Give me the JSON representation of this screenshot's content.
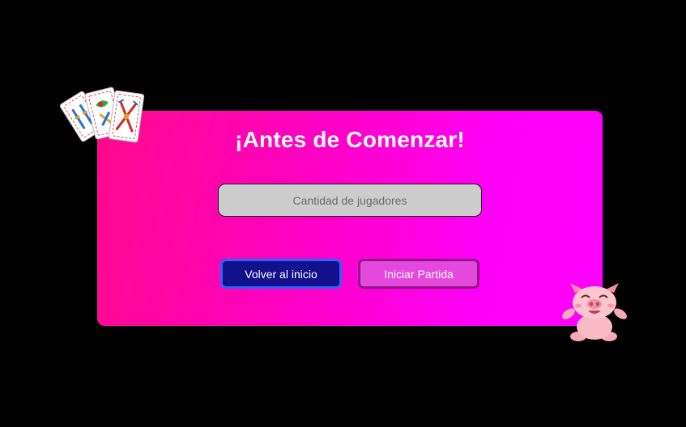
{
  "panel": {
    "title": "¡Antes de Comenzar!"
  },
  "players_input": {
    "placeholder": "Cantidad de jugadores",
    "value": ""
  },
  "buttons": {
    "back_label": "Volver al inicio",
    "start_label": "Iniciar Partida"
  },
  "decorations": {
    "cards_icon": "spanish-playing-cards-icon",
    "pig_icon": "happy-pig-icon"
  },
  "colors": {
    "background": "#000000",
    "panel_gradient_start": "#ff0a8c",
    "panel_gradient_end": "#ff00ff",
    "back_button": "#12108a",
    "start_button": "#e448dc"
  }
}
